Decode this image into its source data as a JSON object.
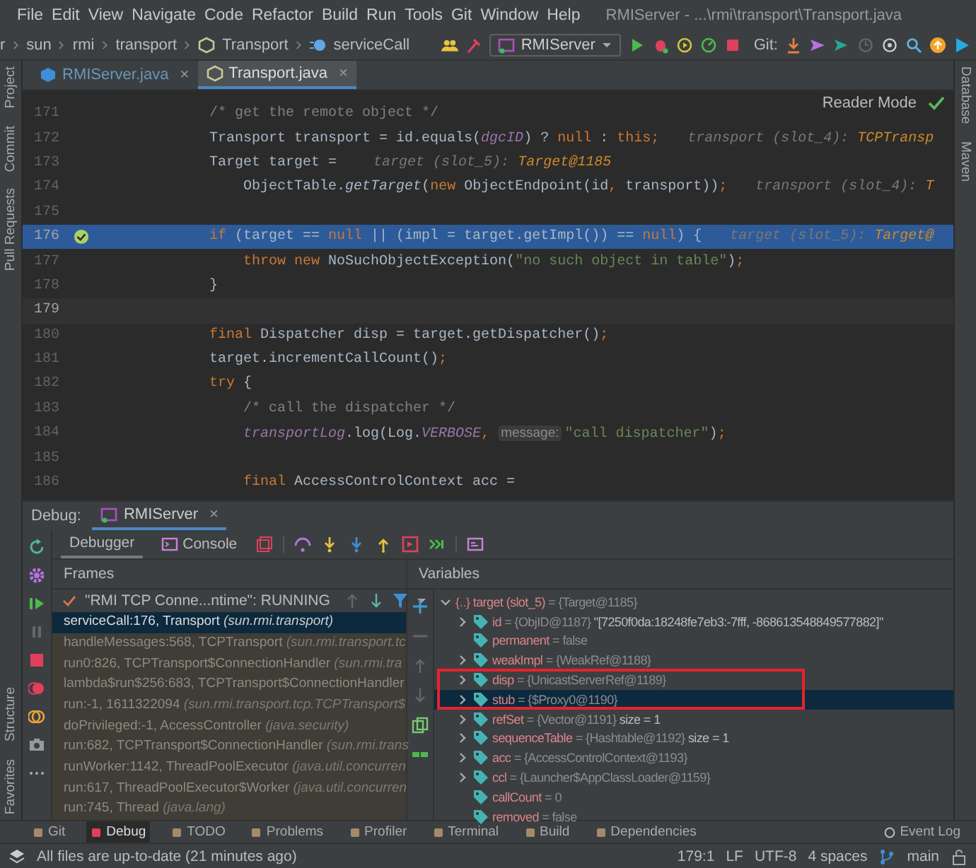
{
  "menu": [
    "File",
    "Edit",
    "View",
    "Navigate",
    "Code",
    "Refactor",
    "Build",
    "Run",
    "Tools",
    "Git",
    "Window",
    "Help"
  ],
  "window": {
    "title": "RMIServer - ...\\rmi\\transport\\Transport.java"
  },
  "breadcrumbs": [
    "r",
    "sun",
    "rmi",
    "transport",
    "Transport",
    "serviceCall"
  ],
  "run_config": "RMIServer",
  "git_label": "Git:",
  "left_strip": {
    "top": [
      "Project",
      "Commit",
      "Pull Requests"
    ],
    "bottom": [
      "Structure",
      "Favorites"
    ]
  },
  "right_strip": [
    "Database",
    "Maven"
  ],
  "editor_tabs": [
    {
      "label": "RMIServer.java",
      "selected": false,
      "modified": true,
      "close": "×"
    },
    {
      "label": "Transport.java",
      "selected": true,
      "modified": false,
      "close": "×"
    }
  ],
  "reader_mode": "Reader Mode",
  "code": [
    {
      "number": "171",
      "current": false,
      "caret": false,
      "breakpoint": false,
      "tokens": [
        {
          "kind": "comment",
          "text": "            /* get the remote object */"
        }
      ]
    },
    {
      "number": "172",
      "current": false,
      "caret": false,
      "breakpoint": false,
      "tokens": [
        {
          "kind": "plain",
          "text": "            Transport transport = id.equals("
        },
        {
          "kind": "field",
          "text": "dgcID"
        },
        {
          "kind": "plain",
          "text": ") ? "
        },
        {
          "kind": "keyword",
          "text": "null"
        },
        {
          "kind": "plain",
          "text": " : "
        },
        {
          "kind": "keyword",
          "text": "this;"
        }
      ],
      "hint": [
        {
          "kind": "name",
          "text": "transport (slot_4): "
        },
        {
          "kind": "value",
          "text": "TCPTransp"
        }
      ]
    },
    {
      "number": "173",
      "current": false,
      "caret": false,
      "breakpoint": false,
      "tokens": [
        {
          "kind": "plain",
          "text": "            Target target = "
        }
      ],
      "hint": [
        {
          "kind": "name",
          "text": "target (slot_5): "
        },
        {
          "kind": "value",
          "text": "Target@1185"
        }
      ]
    },
    {
      "number": "174",
      "current": false,
      "caret": false,
      "breakpoint": false,
      "tokens": [
        {
          "kind": "plain",
          "text": "                ObjectTable."
        },
        {
          "kind": "static",
          "text": "getTarget"
        },
        {
          "kind": "plain",
          "text": "("
        },
        {
          "kind": "keyword",
          "text": "new "
        },
        {
          "kind": "plain",
          "text": "ObjectEndpoint(id"
        },
        {
          "kind": "keyword",
          "text": ", "
        },
        {
          "kind": "plain",
          "text": "transport))"
        },
        {
          "kind": "keyword",
          "text": ";"
        }
      ],
      "hint": [
        {
          "kind": "name",
          "text": "transport (slot_4): "
        },
        {
          "kind": "value",
          "text": "T"
        }
      ]
    },
    {
      "number": "175",
      "current": false,
      "caret": false,
      "breakpoint": false
    },
    {
      "number": "176",
      "current": true,
      "caret": false,
      "breakpoint": true,
      "tokens": [
        {
          "kind": "keyword",
          "text": "            if "
        },
        {
          "kind": "plain",
          "text": "(target == "
        },
        {
          "kind": "keyword",
          "text": "null"
        },
        {
          "kind": "plain",
          "text": " || (impl = target.getImpl()) == "
        },
        {
          "kind": "keyword",
          "text": "null"
        },
        {
          "kind": "plain",
          "text": ") {"
        }
      ],
      "hint": [
        {
          "kind": "name",
          "text": "target (slot_5): "
        },
        {
          "kind": "value",
          "text": "Target@"
        }
      ]
    },
    {
      "number": "177",
      "current": false,
      "caret": false,
      "breakpoint": false,
      "tokens": [
        {
          "kind": "keyword",
          "text": "                throw new "
        },
        {
          "kind": "plain",
          "text": "NoSuchObjectException("
        },
        {
          "kind": "string",
          "text": "\"no such object in table\""
        },
        {
          "kind": "plain",
          "text": ")"
        },
        {
          "kind": "keyword",
          "text": ";"
        }
      ]
    },
    {
      "number": "178",
      "current": false,
      "caret": false,
      "breakpoint": false,
      "tokens": [
        {
          "kind": "plain",
          "text": "            }"
        }
      ]
    },
    {
      "number": "179",
      "current": false,
      "caret": true,
      "breakpoint": false
    },
    {
      "number": "180",
      "current": false,
      "caret": false,
      "breakpoint": false,
      "tokens": [
        {
          "kind": "keyword",
          "text": "            final "
        },
        {
          "kind": "plain",
          "text": "Dispatcher disp = target.getDispatcher()"
        },
        {
          "kind": "keyword",
          "text": ";"
        }
      ]
    },
    {
      "number": "181",
      "current": false,
      "caret": false,
      "breakpoint": false,
      "tokens": [
        {
          "kind": "plain",
          "text": "            target.incrementCallCount()"
        },
        {
          "kind": "keyword",
          "text": ";"
        }
      ]
    },
    {
      "number": "182",
      "current": false,
      "caret": false,
      "breakpoint": false,
      "tokens": [
        {
          "kind": "keyword",
          "text": "            try "
        },
        {
          "kind": "plain",
          "text": "{"
        }
      ]
    },
    {
      "number": "183",
      "current": false,
      "caret": false,
      "breakpoint": false,
      "tokens": [
        {
          "kind": "comment",
          "text": "                /* call the dispatcher */"
        }
      ]
    },
    {
      "number": "184",
      "current": false,
      "caret": false,
      "breakpoint": false,
      "tokens": [
        {
          "kind": "field",
          "text": "                transportLog"
        },
        {
          "kind": "plain",
          "text": ".log(Log."
        },
        {
          "kind": "field",
          "text": "VERBOSE"
        },
        {
          "kind": "keyword",
          "text": ", "
        },
        {
          "kind": "param",
          "text": "message:"
        },
        {
          "kind": "string",
          "text": "\"call dispatcher\""
        },
        {
          "kind": "plain",
          "text": ")"
        },
        {
          "kind": "keyword",
          "text": ";"
        }
      ]
    },
    {
      "number": "185",
      "current": false,
      "caret": false,
      "breakpoint": false
    },
    {
      "number": "186",
      "current": false,
      "caret": false,
      "breakpoint": false,
      "tokens": [
        {
          "kind": "keyword",
          "text": "                final "
        },
        {
          "kind": "plain",
          "text": "AccessControlContext acc ="
        }
      ]
    }
  ],
  "debug": {
    "label": "Debug:",
    "session": {
      "label": "RMIServer",
      "close": "×"
    },
    "tabs": [
      {
        "label": "Debugger",
        "selected": true
      },
      {
        "label": "Console",
        "selected": false
      }
    ],
    "frames_title": "Frames",
    "thread": "\"RMI TCP Conne...ntime\": RUNNING",
    "frames": [
      {
        "text": "serviceCall:176, Transport",
        "package": "(sun.rmi.transport)",
        "selected": true
      },
      {
        "text": "handleMessages:568, TCPTransport",
        "package": "(sun.rmi.transport.tc",
        "selected": false
      },
      {
        "text": "run0:826, TCPTransport$ConnectionHandler",
        "package": "(sun.rmi.tra",
        "selected": false
      },
      {
        "text": "lambda$run$256:683, TCPTransport$ConnectionHandler",
        "selected": false
      },
      {
        "text": "run:-1, 1611322094",
        "package": "(sun.rmi.transport.tcp.TCPTransport$",
        "selected": false
      },
      {
        "text": "doPrivileged:-1, AccessController",
        "package": "(java.security)",
        "selected": false
      },
      {
        "text": "run:682, TCPTransport$ConnectionHandler",
        "package": "(sun.rmi.trans",
        "selected": false
      },
      {
        "text": "runWorker:1142, ThreadPoolExecutor",
        "package": "(java.util.concurren",
        "selected": false
      },
      {
        "text": "run:617, ThreadPoolExecutor$Worker",
        "package": "(java.util.concurren",
        "selected": false
      },
      {
        "text": "run:745, Thread",
        "package": "(java.lang)",
        "selected": false
      }
    ],
    "variables_title": "Variables",
    "variables": [
      {
        "kind": "object",
        "icon": "{..}",
        "name": "target (slot_5)",
        "value": "= {Target@1185}",
        "expandable": true,
        "expanded": true,
        "selected": false,
        "outlined": false,
        "children": [
          {
            "kind": "field",
            "name": "id",
            "value": "= {ObjID@1187}",
            "extra": "\"[7250f0da:18248fe7eb3:-7fff, -868613548849577882]\"",
            "expandable": true,
            "expanded": false,
            "selected": false,
            "outlined": false
          },
          {
            "kind": "field",
            "name": "permanent",
            "value": "= false",
            "expandable": false,
            "selected": false,
            "outlined": false
          },
          {
            "kind": "field",
            "name": "weakImpl",
            "value": "= {WeakRef@1188}",
            "expandable": true,
            "expanded": false,
            "selected": false,
            "outlined": false
          },
          {
            "kind": "field",
            "name": "disp",
            "value": "= {UnicastServerRef@1189}",
            "expandable": true,
            "expanded": false,
            "selected": false,
            "outlined": true
          },
          {
            "kind": "field",
            "name": "stub",
            "value": "= {$Proxy0@1190}",
            "expandable": true,
            "expanded": false,
            "selected": true,
            "outlined": true
          },
          {
            "kind": "field",
            "name": "refSet",
            "value": "= {Vector@1191}",
            "extra": "size = 1",
            "expandable": true,
            "expanded": false,
            "selected": false,
            "outlined": false
          },
          {
            "kind": "field",
            "name": "sequenceTable",
            "value": "= {Hashtable@1192}",
            "extra": "size = 1",
            "expandable": true,
            "expanded": false,
            "selected": false,
            "outlined": false
          },
          {
            "kind": "field",
            "name": "acc",
            "value": "= {AccessControlContext@1193}",
            "expandable": true,
            "expanded": false,
            "selected": false,
            "outlined": false
          },
          {
            "kind": "field",
            "name": "ccl",
            "value": "= {Launcher$AppClassLoader@1159}",
            "expandable": true,
            "expanded": false,
            "selected": false,
            "outlined": false
          },
          {
            "kind": "field",
            "name": "callCount",
            "value": "= 0",
            "expandable": false,
            "selected": false,
            "outlined": false
          },
          {
            "kind": "field",
            "name": "removed",
            "value": "= false",
            "expandable": false,
            "selected": false,
            "outlined": false
          }
        ]
      }
    ]
  },
  "tool_windows": [
    {
      "label": "Git",
      "selected": false
    },
    {
      "label": "Debug",
      "selected": true
    },
    {
      "label": "TODO",
      "selected": false
    },
    {
      "label": "Problems",
      "selected": false
    },
    {
      "label": "Profiler",
      "selected": false
    },
    {
      "label": "Terminal",
      "selected": false
    },
    {
      "label": "Build",
      "selected": false
    },
    {
      "label": "Dependencies",
      "selected": false
    }
  ],
  "event_log": "Event Log",
  "status": {
    "message": "All files are up-to-date (21 minutes ago)",
    "items": [
      "179:1",
      "LF",
      "UTF-8",
      "4 spaces"
    ],
    "branch": "main"
  }
}
